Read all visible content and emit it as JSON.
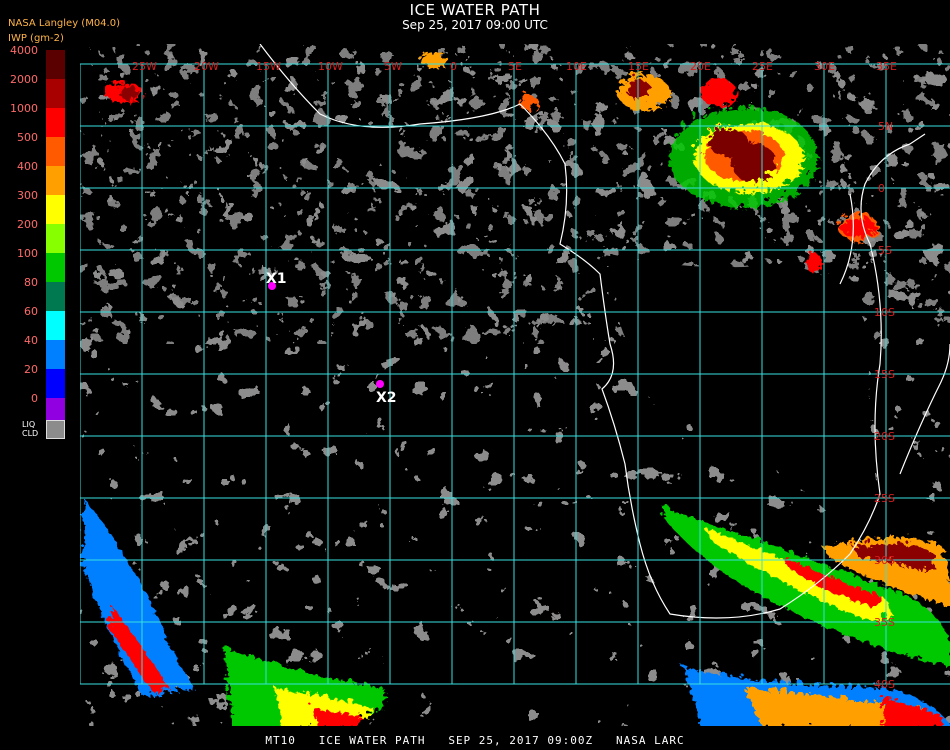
{
  "header": {
    "title": "ICE WATER PATH",
    "subtitle": "Sep 25, 2017 09:00 UTC",
    "producer": "NASA Langley (M04.0)",
    "units": "IWP (gm-2)"
  },
  "legend": {
    "labels": [
      "4000",
      "2000",
      "1000",
      "500",
      "400",
      "300",
      "200",
      "100",
      "80",
      "60",
      "40",
      "20",
      "0"
    ],
    "colors": [
      "#5a0000",
      "#a80000",
      "#ff0000",
      "#ff5a00",
      "#ffa000",
      "#ffff00",
      "#88ff00",
      "#00c800",
      "#007850",
      "#00ffff",
      "#0080ff",
      "#0000ff",
      "#9000e0"
    ],
    "liquid_label_1": "LIQ",
    "liquid_label_2": "CLD",
    "liquid_color": "#8c8c8c"
  },
  "map": {
    "grid_color": "#37e0e0",
    "coast_color": "#ffffff",
    "lon_labels": [
      "25W",
      "20W",
      "15W",
      "10W",
      "5W",
      "0",
      "5E",
      "10E",
      "15E",
      "20E",
      "25E",
      "30E",
      "35E"
    ],
    "lat_labels": [
      "5N",
      "0",
      "5S",
      "10S",
      "15S",
      "20S",
      "25S",
      "30S",
      "35S",
      "40S"
    ],
    "markers": [
      {
        "label": "X1",
        "color": "#ff00ff"
      },
      {
        "label": "X2",
        "color": "#ff00ff"
      }
    ]
  },
  "footer": "MT10   ICE WATER PATH   SEP 25, 2017 09:00Z   NASA LARC"
}
